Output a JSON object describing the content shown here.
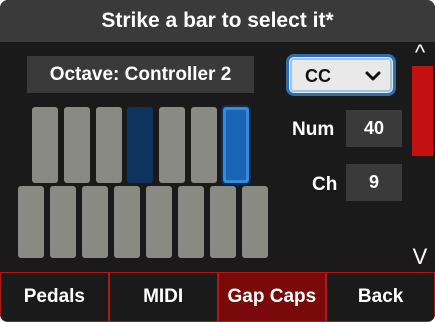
{
  "header": {
    "title": "Strike a bar to select it*"
  },
  "octave": {
    "label": "Octave: Controller 2"
  },
  "bars": {
    "top": [
      {
        "state": "normal"
      },
      {
        "state": "normal"
      },
      {
        "state": "normal"
      },
      {
        "state": "dim"
      },
      {
        "state": "normal"
      },
      {
        "state": "normal"
      },
      {
        "state": "selected"
      }
    ],
    "bottom": [
      {
        "state": "normal"
      },
      {
        "state": "normal"
      },
      {
        "state": "normal"
      },
      {
        "state": "normal"
      },
      {
        "state": "normal"
      },
      {
        "state": "normal"
      },
      {
        "state": "normal"
      },
      {
        "state": "normal"
      }
    ]
  },
  "mode_select": {
    "value": "CC",
    "icon": "chevron-down-icon"
  },
  "fields": {
    "num": {
      "label": "Num",
      "value": "40"
    },
    "ch": {
      "label": "Ch",
      "value": "9"
    }
  },
  "scroll": {
    "up_icon": "chevron-up-icon",
    "down_icon": "chevron-down-icon",
    "up_glyph": "^",
    "down_glyph": "V"
  },
  "nav": {
    "pedals": "Pedals",
    "midi": "MIDI",
    "gap_caps": "Gap Caps",
    "back": "Back",
    "active": "gap_caps"
  },
  "colors": {
    "accent_red": "#c41010",
    "selected_blue": "#1765b4",
    "bar_gray": "#8a8a85",
    "dim_blue": "#0f3460"
  }
}
